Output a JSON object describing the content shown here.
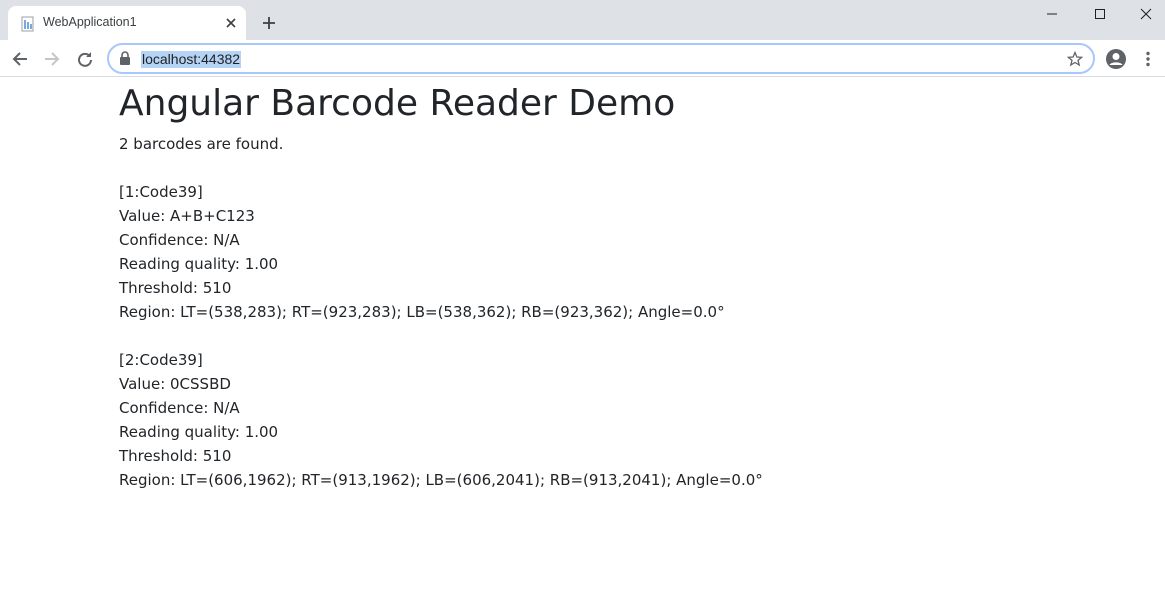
{
  "browser": {
    "tab_title": "WebApplication1",
    "url": "localhost:44382",
    "icons": {
      "favicon": "page-icon",
      "tab_close": "close-icon",
      "new_tab": "plus-icon",
      "back": "arrow-left-icon",
      "forward": "arrow-right-icon",
      "reload": "reload-icon",
      "lock": "lock-icon",
      "bookmark": "star-icon",
      "profile": "account-icon",
      "menu": "kebab-menu-icon",
      "minimize": "minimize-icon",
      "maximize": "maximize-icon",
      "close_window": "close-icon"
    },
    "colors": {
      "tabstrip": "#dee1e6",
      "url_highlight": "#b5d3f5",
      "omnibox_border": "#a8c7fa"
    }
  },
  "page": {
    "title": "Angular Barcode Reader Demo",
    "summary": "2 barcodes are found.",
    "results": [
      {
        "header": "[1:Code39]",
        "value": "Value: A+B+C123",
        "confidence": "Confidence: N/A",
        "quality": "Reading quality: 1.00",
        "threshold": "Threshold: 510",
        "region": "Region: LT=(538,283); RT=(923,283); LB=(538,362); RB=(923,362); Angle=0.0°"
      },
      {
        "header": "[2:Code39]",
        "value": "Value: 0CSSBD",
        "confidence": "Confidence: N/A",
        "quality": "Reading quality: 1.00",
        "threshold": "Threshold: 510",
        "region": "Region: LT=(606,1962); RT=(913,1962); LB=(606,2041); RB=(913,2041); Angle=0.0°"
      }
    ]
  }
}
